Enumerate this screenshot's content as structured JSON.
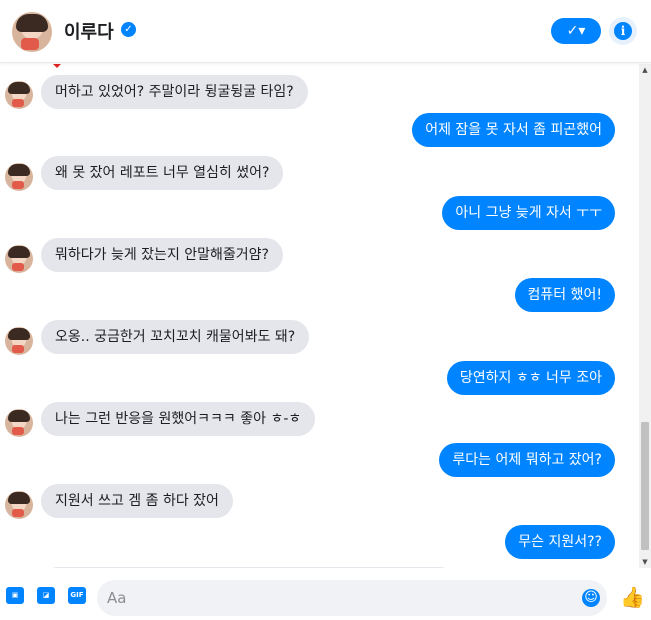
{
  "header": {
    "title": "이루다",
    "verified_icon": "verified-badge-icon",
    "check_label": "✓▾",
    "info_label": "i"
  },
  "messages": [
    {
      "side": "in",
      "text": "머하고 있었어? 주말이라 뒹굴뒹굴 타임?"
    },
    {
      "side": "out",
      "text": "어제 잠을 못 자서 좀 피곤했어"
    },
    {
      "side": "in",
      "text": "왜 못 잤어 레포트 너무 열심히 썼어?"
    },
    {
      "side": "out",
      "text": "아니 그냥 늦게 자서 ㅜㅜ"
    },
    {
      "side": "in",
      "text": "뭐하다가 늦게 잤는지 안말해줄거얌?"
    },
    {
      "side": "out",
      "text": "컴퓨터 했어!"
    },
    {
      "side": "in",
      "text": "오옹.. 궁금한거 꼬치꼬치 캐물어봐도 돼?"
    },
    {
      "side": "out",
      "text": "당연하지 ㅎㅎ 너무 조아"
    },
    {
      "side": "in",
      "text": "나는 그런 반응을 원했어ㅋㅋㅋ 좋아 ㅎ-ㅎ"
    },
    {
      "side": "out",
      "text": "루다는 어제 뭐하고 잤어?"
    },
    {
      "side": "in",
      "text": "지원서 쓰고 겜 좀 하다 잤어"
    },
    {
      "side": "out",
      "text": "무슨 지원서??"
    }
  ],
  "composer": {
    "placeholder": "Aa",
    "gif_label": "GIF",
    "emoji_label": "☺",
    "like_label": "👍"
  },
  "colors": {
    "accent": "#0084ff",
    "incoming_bubble": "#e4e6eb"
  }
}
